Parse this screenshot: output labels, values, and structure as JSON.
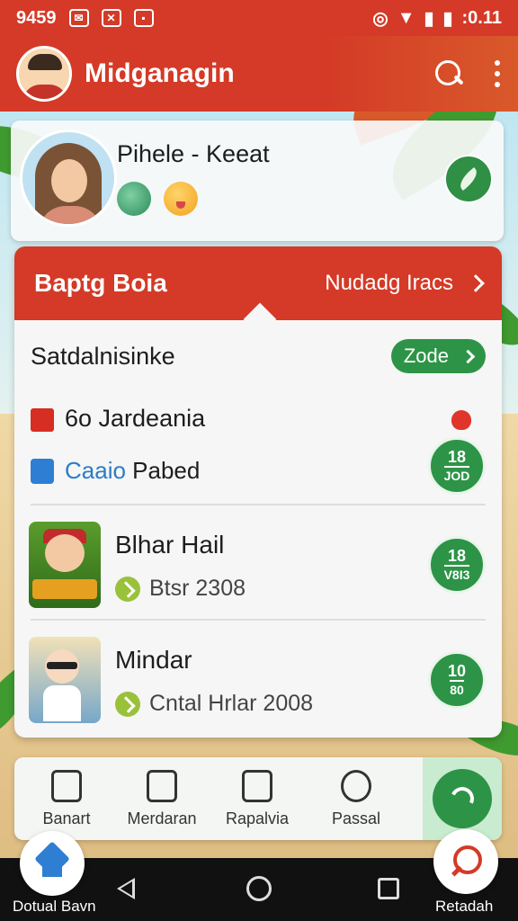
{
  "status_bar": {
    "left_text": "9459",
    "time": ":0.11"
  },
  "app_bar": {
    "title": "Midganagin"
  },
  "profile": {
    "name": "Pihele - Keeat"
  },
  "card": {
    "header_title": "Baptg Boia",
    "header_link": "Nudadg Iracs",
    "section_title": "Satdalnisinke",
    "zone_label": "Zode"
  },
  "item1": {
    "title": "6o Jardeania",
    "sub_blue": "Caaio",
    "sub_rest": " Pabed",
    "badge_top": "18",
    "badge_bottom": "JOD"
  },
  "games": [
    {
      "title": "Blhar Hail",
      "meta": "Btsr 2308",
      "badge_top": "18",
      "badge_bottom": "V8I3"
    },
    {
      "title": "Mindar",
      "meta": "Cntal Hrlar 2008",
      "badge_top": "10",
      "badge_bottom": "80"
    }
  ],
  "toolbar": {
    "items": [
      {
        "label": "Banart"
      },
      {
        "label": "Merdaran"
      },
      {
        "label": "Rapalvia"
      },
      {
        "label": "Passal"
      }
    ]
  },
  "nav": {
    "left_label": "Dotual Bavn",
    "right_label": "Retadah"
  },
  "colors": {
    "primary_red": "#d43a27",
    "accent_green": "#2d9447",
    "link_blue": "#2c7cc9"
  }
}
